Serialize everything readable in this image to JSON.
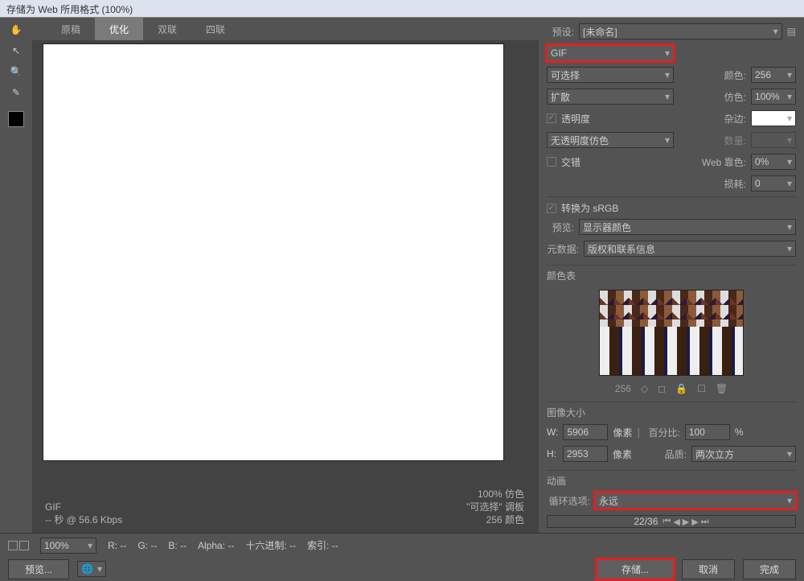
{
  "window": {
    "title": "存储为 Web 所用格式 (100%)"
  },
  "tabs": {
    "raw": "原稿",
    "optimized": "优化",
    "two": "双联",
    "four": "四联"
  },
  "canvas_info": {
    "left_format": "GIF",
    "left_speed": "-- 秒 @ 56.6 Kbps",
    "right1": "100% 仿色",
    "right2": "\"可选择\" 调板",
    "right3": "256 颜色"
  },
  "preset": {
    "label": "预设:",
    "value": "[未命名]"
  },
  "format": {
    "value": "GIF"
  },
  "reduction": {
    "value": "可选择"
  },
  "dither": {
    "value": "扩散"
  },
  "transparency": {
    "label": "透明度"
  },
  "trans_dither": {
    "value": "无透明度仿色"
  },
  "interlace": {
    "label": "交错"
  },
  "colors": {
    "label": "颜色:",
    "value": "256"
  },
  "dither_amt": {
    "label": "仿色:",
    "value": "100%"
  },
  "matte": {
    "label": "杂边:"
  },
  "amount": {
    "label": "数量:"
  },
  "websnap": {
    "label": "Web 靠色:",
    "value": "0%"
  },
  "lossy": {
    "label": "损耗:",
    "value": "0"
  },
  "srgb": {
    "label": "转换为 sRGB"
  },
  "preview": {
    "label": "预览:",
    "value": "显示器颜色"
  },
  "metadata": {
    "label": "元数据:",
    "value": "版权和联系信息"
  },
  "colortable": {
    "label": "颜色表",
    "count": "256"
  },
  "imagesize": {
    "label": "图像大小",
    "w": "5906",
    "h": "2953",
    "px": "像素",
    "percent_label": "百分比:",
    "percent": "100",
    "quality_label": "品质:",
    "quality": "两次立方",
    "pct_sign": "%",
    "w_label": "W:",
    "h_label": "H:"
  },
  "animation": {
    "label": "动画",
    "loop_label": "循环选项:",
    "loop": "永远",
    "frames": "22/36"
  },
  "strip": {
    "zoom": "100%",
    "r": "R: --",
    "g": "G: --",
    "b": "B: --",
    "alpha": "Alpha: --",
    "hex": "十六进制: --",
    "index": "索引: --"
  },
  "buttons": {
    "preview": "预览...",
    "save": "存储...",
    "cancel": "取消",
    "done": "完成"
  }
}
